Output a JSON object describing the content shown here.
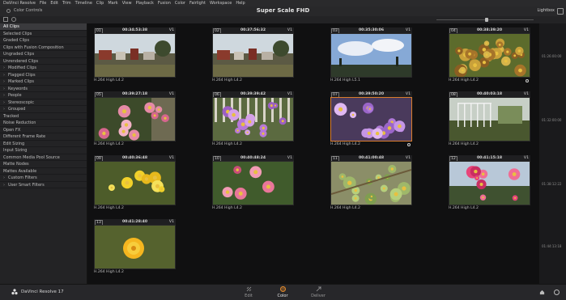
{
  "menu": [
    "DaVinci Resolve",
    "File",
    "Edit",
    "Trim",
    "Timeline",
    "Clip",
    "Mark",
    "View",
    "Playback",
    "Fusion",
    "Color",
    "Fairlight",
    "Workspace",
    "Help"
  ],
  "titlebar": {
    "left_label": "Color Controls",
    "project_title": "Super Scale FHD",
    "right_label": "Lightbox"
  },
  "sidebar": {
    "items": [
      {
        "label": "All Clips",
        "chevron": false,
        "selected": true
      },
      {
        "label": "Selected Clips",
        "chevron": false
      },
      {
        "label": "Graded Clips",
        "chevron": false
      },
      {
        "label": "Clips with Fusion Composition",
        "chevron": false
      },
      {
        "label": "Ungraded Clips",
        "chevron": false
      },
      {
        "label": "Unrendered Clips",
        "chevron": false
      },
      {
        "label": "Modified Clips",
        "chevron": true
      },
      {
        "label": "Flagged Clips",
        "chevron": true
      },
      {
        "label": "Marked Clips",
        "chevron": true
      },
      {
        "label": "Keywords",
        "chevron": true
      },
      {
        "label": "People",
        "chevron": true
      },
      {
        "label": "Stereoscopic",
        "chevron": true
      },
      {
        "label": "Grouped",
        "chevron": true
      },
      {
        "label": "Tracked",
        "chevron": false
      },
      {
        "label": "Noise Reduction",
        "chevron": false
      },
      {
        "label": "Open FX",
        "chevron": false
      },
      {
        "label": "Different Frame Rate",
        "chevron": false
      },
      {
        "label": "Edit Sizing",
        "chevron": false
      },
      {
        "label": "Input Sizing",
        "chevron": false
      },
      {
        "label": "Common Media Pool Source",
        "chevron": false
      },
      {
        "label": "Matte Nodes",
        "chevron": false
      },
      {
        "label": "Mattes Available",
        "chevron": false
      },
      {
        "label": "Custom Filters",
        "chevron": true
      },
      {
        "label": "User Smart Filters",
        "chevron": true
      }
    ]
  },
  "clips": [
    {
      "num": "01",
      "timecode": "00:34:53:38",
      "track": "V1",
      "codec": "H.264 High L4.2",
      "scene": "village",
      "badge": false
    },
    {
      "num": "02",
      "timecode": "00:37:56:32",
      "track": "V1",
      "codec": "H.264 High L4.2",
      "scene": "village",
      "badge": false
    },
    {
      "num": "03",
      "timecode": "00:35:30:06",
      "track": "V1",
      "codec": "H.264 High L5.1",
      "scene": "sky",
      "badge": false
    },
    {
      "num": "04",
      "timecode": "00:38:39:20",
      "track": "V1",
      "codec": "H.264 High L4.2",
      "scene": "leaves",
      "badge": true
    },
    {
      "num": "05",
      "timecode": "00:39:27:18",
      "track": "V1",
      "codec": "H.264 High L4.2",
      "scene": "pinkflower",
      "badge": false
    },
    {
      "num": "06",
      "timecode": "00:39:39:42",
      "track": "V1",
      "codec": "H.264 High L4.2",
      "scene": "purplefence",
      "badge": false
    },
    {
      "num": "07",
      "timecode": "00:39:50:20",
      "track": "V1",
      "codec": "H.264 High L4.2",
      "scene": "purpledaisy",
      "badge": true,
      "selected": true
    },
    {
      "num": "08",
      "timecode": "00:40:03:18",
      "track": "V1",
      "codec": "H.264 High L4.2",
      "scene": "greenhouse",
      "badge": false
    },
    {
      "num": "09",
      "timecode": "00:40:36:48",
      "track": "V1",
      "codec": "H.264 High L4.2",
      "scene": "yellowflower",
      "badge": false
    },
    {
      "num": "10",
      "timecode": "00:40:48:24",
      "track": "V1",
      "codec": "H.264 High L4.2",
      "scene": "pinkrose",
      "badge": false
    },
    {
      "num": "11",
      "timecode": "00:41:00:48",
      "track": "V1",
      "codec": "H.264 High L4.2",
      "scene": "greenbuds",
      "badge": false
    },
    {
      "num": "12",
      "timecode": "00:41:15:18",
      "track": "V1",
      "codec": "H.264 High L4.2",
      "scene": "pinkfuchsia",
      "badge": false
    },
    {
      "num": "13",
      "timecode": "00:41:28:40",
      "track": "V1",
      "codec": "H.264 High L4.2",
      "scene": "yellowmarigold",
      "badge": false
    }
  ],
  "right_timecodes": [
    "01:26:00:00",
    "01:32:00:00",
    "01:38:12:22",
    "01:44:13:18"
  ],
  "bottom": {
    "app_name": "DaVinci Resolve 17",
    "pages": [
      "Edit",
      "Color",
      "Deliver"
    ],
    "active_page": "Color"
  },
  "colors": {
    "accent": "#e58b2c",
    "selection_border": "#d97d2c"
  }
}
